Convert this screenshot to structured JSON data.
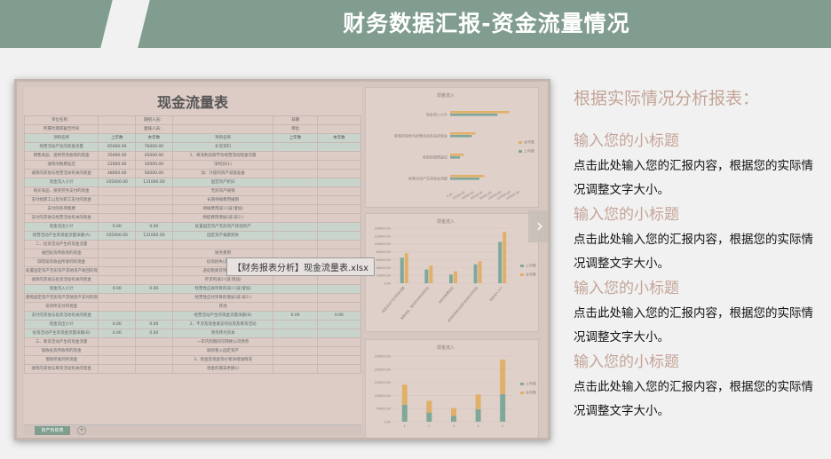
{
  "header": {
    "title": "财务数据汇报-资金流量情况"
  },
  "screenshot": {
    "sheet_title": "现金流量表",
    "tooltip": "【财务报表分析】现金流量表.xlsx",
    "nav_glyph": "›",
    "tab_label": "资产负债表",
    "tab_add": "+",
    "meta_rows": [
      [
        "单位名称：",
        "",
        "期初人员：",
        "",
        "日期",
        ""
      ],
      [
        "所属时期或截至时间",
        "",
        "复核人员：",
        "",
        "单位",
        ""
      ]
    ],
    "col_headers": [
      "项目名称",
      "上年数",
      "本年数",
      "项目名称",
      "上年数",
      "本年数"
    ],
    "rows": [
      {
        "c": [
          "经营活动产生的现金流量",
          "65000.00",
          "76000.00",
          "补充资料",
          "",
          ""
        ],
        "hl": true
      },
      {
        "c": [
          "销售商品、提供劳务收到的现金",
          "35000.00",
          "45000.00",
          "1、将净利润调节为经营活动现金流量",
          "",
          ""
        ]
      },
      {
        "c": [
          "收到的税费返还",
          "22000.00",
          "30000.00",
          "净利润(1)",
          "",
          ""
        ]
      },
      {
        "c": [
          "收到的其他与经营活动有关的现金",
          "48000.00",
          "56000.00",
          "加：计提的资产减值准备",
          "",
          ""
        ]
      },
      {
        "c": [
          "现金流入小计",
          "105000.00",
          "131000.00",
          "固定资产折旧",
          "",
          ""
        ],
        "hl": true
      },
      {
        "c": [
          "购买商品、接受劳务支付的现金",
          "",
          "",
          "无形资产摊销",
          "",
          ""
        ]
      },
      {
        "c": [
          "支付给职工以及为职工支付的现金",
          "",
          "",
          "长期待摊费用摊销",
          "",
          ""
        ]
      },
      {
        "c": [
          "支付的各项税费",
          "",
          "",
          "待摊费用减少(减:增加)",
          "",
          ""
        ]
      },
      {
        "c": [
          "支付的其他与经营活动有关的现金",
          "",
          "",
          "预提费用增加(减:减少)",
          "",
          ""
        ]
      },
      {
        "c": [
          "现金流出小计",
          "0.00",
          "0.00",
          "处置固定资产无形资产其他资产",
          "",
          ""
        ],
        "hl": true
      },
      {
        "c": [
          "经营活动产生的现金流量净额(A)",
          "105000.00",
          "131000.00",
          "固定资产报废损失",
          "",
          ""
        ],
        "hl": true
      },
      {
        "c": [
          "二、投资活动产生的现金流量",
          "",
          "",
          "",
          "",
          ""
        ]
      },
      {
        "c": [
          "收回投资所收到的现金",
          "",
          "",
          "财务费用",
          "",
          ""
        ]
      },
      {
        "c": [
          "取得投资收益所收到的现金",
          "",
          "",
          "投资损失(减:收益)",
          "",
          ""
        ]
      },
      {
        "c": [
          "处置固定资产无形资产其他资产收回的现金净额",
          "",
          "",
          "递延税款贷项(减:借项)",
          "",
          ""
        ]
      },
      {
        "c": [
          "收到的其他与投资活动有关的现金",
          "",
          "",
          "存货的减少(减:增加)",
          "",
          ""
        ]
      },
      {
        "c": [
          "现金流入小计",
          "0.00",
          "0.00",
          "经营性应收项目的减少(减:增加)",
          "",
          ""
        ],
        "hl": true
      },
      {
        "c": [
          "建购固定资产无形资产其他资产支付的现金",
          "",
          "",
          "经营性应付项目的增加(减:减少)",
          "",
          ""
        ]
      },
      {
        "c": [
          "投资所支付的现金",
          "",
          "",
          "其他",
          "",
          ""
        ]
      },
      {
        "c": [
          "支付的其他与投资活动有关的现金",
          "",
          "",
          "经营活动产生的现金流量净额(B)",
          "0.00",
          "0.00"
        ],
        "hl": true
      },
      {
        "c": [
          "现金流出小计",
          "0.00",
          "0.00",
          "2、不涉及现金收支的投资及筹资活动",
          "",
          ""
        ],
        "hl": true
      },
      {
        "c": [
          "投资活动产生的现金流量净额(B)",
          "0.00",
          "0.00",
          "债务转为资本",
          "",
          ""
        ],
        "hl": true
      },
      {
        "c": [
          "三、筹资活动产生的现金流量",
          "",
          "",
          "一年内到期的可转换公司债券",
          "",
          ""
        ]
      },
      {
        "c": [
          "吸收投资所收到的现金",
          "",
          "",
          "融资租入固定资产",
          "",
          ""
        ]
      },
      {
        "c": [
          "借款所收到的现金",
          "",
          "",
          "3、现金及现金等价物净增加情况",
          "",
          ""
        ]
      },
      {
        "c": [
          "收到的其他与筹资活动有关的现金",
          "",
          "",
          "现金的期末余额(i)",
          "",
          ""
        ]
      }
    ]
  },
  "chart_data": [
    {
      "type": "bar",
      "orientation": "horizontal",
      "title": "现金流入",
      "categories": [
        "经营活动产生的现金流量",
        "收到的税费返还",
        "收到的其他与经营活动有关的现金",
        "现金流入小计"
      ],
      "series": [
        {
          "name": "本年数",
          "values": [
            76000,
            30000,
            56000,
            131000
          ]
        },
        {
          "name": "上年数",
          "values": [
            65000,
            22000,
            48000,
            105000
          ]
        }
      ],
      "xlim": [
        0,
        140000
      ],
      "ticks": [
        "0.00",
        "20000.00",
        "40000.00",
        "60000.00",
        "80000.00",
        "100000.00",
        "120000.00",
        "140000.00"
      ]
    },
    {
      "type": "bar",
      "title": "现金流入",
      "categories": [
        "经营活动产生的现金流量",
        "销售商品、提供劳务收到的现金",
        "收到的税费返还",
        "收到的其他与经营活动有关的现金",
        "现金流入小计"
      ],
      "series": [
        {
          "name": "上年数",
          "values": [
            65000,
            35000,
            22000,
            48000,
            105000
          ]
        },
        {
          "name": "本年数",
          "values": [
            76000,
            45000,
            30000,
            56000,
            131000
          ]
        }
      ],
      "ylim": [
        0,
        140000
      ],
      "ticks": [
        "0.00",
        "20000.00",
        "40000.00",
        "60000.00",
        "80000.00",
        "100000.00",
        "120000.00",
        "140000.00"
      ]
    },
    {
      "type": "bar",
      "stacked": true,
      "title": "现金流入",
      "categories": [
        "1",
        "2",
        "3",
        "4",
        "5"
      ],
      "series": [
        {
          "name": "上年数",
          "values": [
            65000,
            35000,
            22000,
            48000,
            105000
          ]
        },
        {
          "name": "本年数",
          "values": [
            76000,
            45000,
            30000,
            56000,
            131000
          ]
        }
      ],
      "ylim": [
        0,
        250000
      ],
      "ticks": [
        "0.00",
        "50000.00",
        "100000.00",
        "150000.00",
        "200000.00",
        "250000.00"
      ]
    }
  ],
  "colors": {
    "bar_a": "#7fa89b",
    "bar_b": "#e0b068"
  },
  "right": {
    "heading": "根据实际情况分析报表：",
    "sections": [
      {
        "subtitle": "输入您的小标题",
        "body": "点击此处输入您的汇报内容，根据您的实际情况调整文字大小。"
      },
      {
        "subtitle": "输入您的小标题",
        "body": "点击此处输入您的汇报内容，根据您的实际情况调整文字大小。"
      },
      {
        "subtitle": "输入您的小标题",
        "body": "点击此处输入您的汇报内容，根据您的实际情况调整文字大小。"
      },
      {
        "subtitle": "输入您的小标题",
        "body": "点击此处输入您的汇报内容，根据您的实际情况调整文字大小。"
      }
    ]
  }
}
